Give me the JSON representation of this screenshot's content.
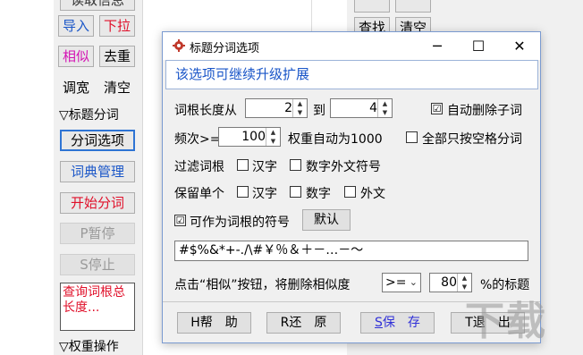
{
  "left_panel": {
    "top_partial_label": "读取信息",
    "buttons": [
      {
        "label": "导入"
      },
      {
        "label": "下拉"
      },
      {
        "label": "相似"
      },
      {
        "label": "去重"
      },
      {
        "label": "调宽"
      },
      {
        "label": "清空"
      }
    ],
    "section_title_segmentation": "▽标题分词",
    "seg_options_label": "分词选项",
    "dict_manage_label": "词典管理",
    "start_seg_label": "开始分词",
    "pause_label": "P暂停",
    "stop_label": "S停止",
    "query_box_text": "查询词根总长度...",
    "section_title_weight": "▽权重操作"
  },
  "right_panel": {
    "find_label": "查找",
    "clear_label": "清空"
  },
  "dialog": {
    "title": "标题分词选项",
    "controls": {
      "minimize": "─",
      "maximize": "☐",
      "close": "✕"
    },
    "banner": "该选项可继续升级扩展",
    "root_length_from_label": "词根长度从",
    "root_length_from_value": "2",
    "to_label": "到",
    "root_length_to_value": "4",
    "auto_delete_sub_label": "自动删除子词",
    "auto_delete_sub_checked": "☑",
    "freq_label": "频次>=",
    "freq_value": "100",
    "weight_auto_label": "权重自动为1000",
    "all_space_only_label": "全部只按空格分词",
    "filter_root_label": "过滤词根",
    "filter_hanzi_label": "汉字",
    "filter_digit_foreign_label": "数字外文符号",
    "keep_single_label": "保留单个",
    "keep_hanzi_label": "汉字",
    "keep_digit_label": "数字",
    "keep_foreign_label": "外文",
    "root_symbols_label": "可作为词根的符号",
    "root_symbols_checked": "☑",
    "default_button_label": "默认",
    "symbols_value": "#$%&*+-./\\#￥％＆＋－…－～",
    "similar_prefix": "点击“相似”按钮，将删除相似度",
    "compare_op_value": ">=",
    "similarity_value": "80",
    "similar_suffix": "%的标题",
    "footer_buttons": {
      "help": "H帮　助",
      "restore": "R还　原",
      "save_hot": "S",
      "save_rest": "保　存",
      "exit": "T退　出"
    }
  },
  "watermark": "下载吧"
}
